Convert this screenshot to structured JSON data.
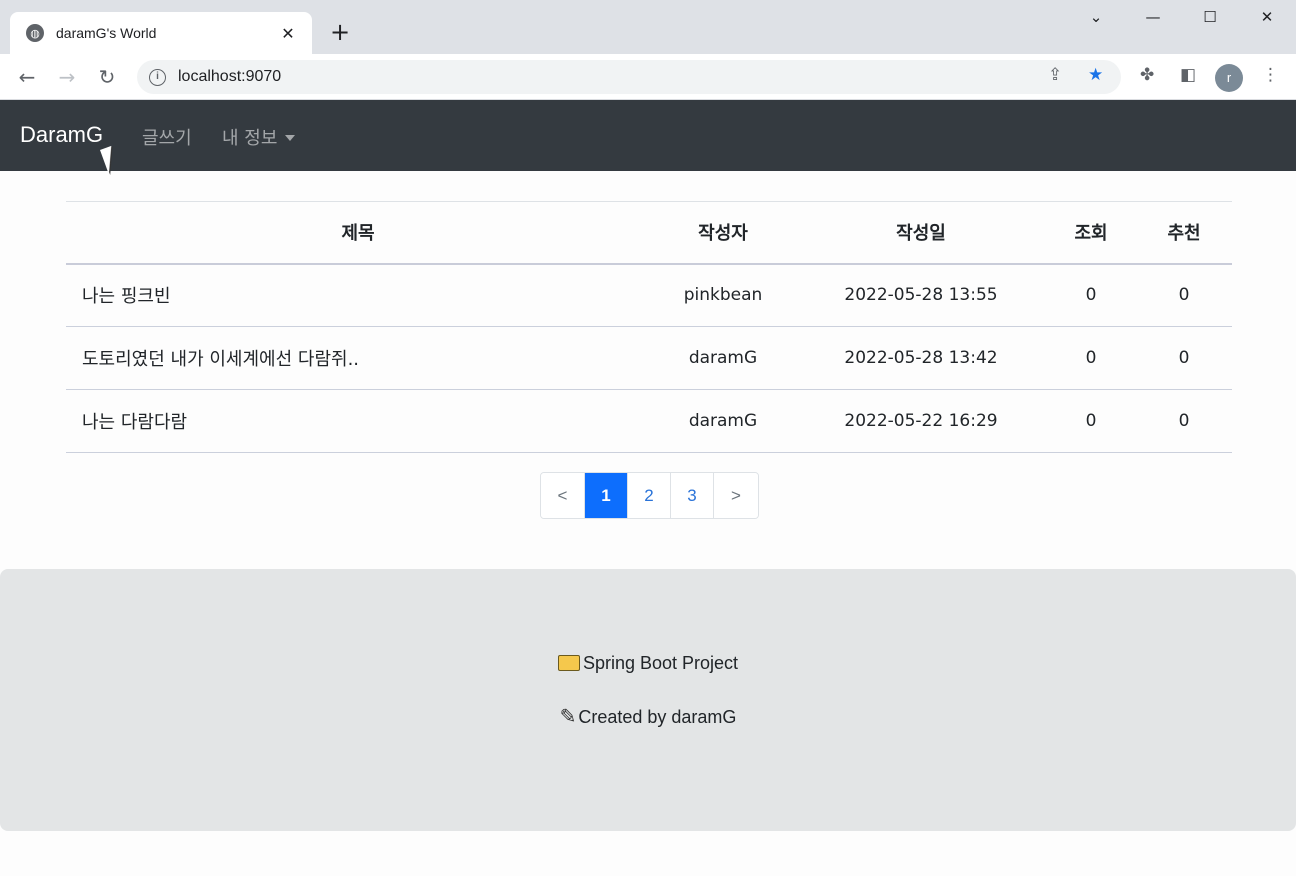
{
  "browser": {
    "tab_title": "daramG's World",
    "tab_close": "✕",
    "new_tab": "+",
    "url": "localhost:9070",
    "profile_initial": "r"
  },
  "navbar": {
    "brand": "DaramG",
    "write_link": "글쓰기",
    "my_info_link": "내 정보"
  },
  "table": {
    "headers": [
      "제목",
      "작성자",
      "작성일",
      "조회",
      "추천"
    ],
    "rows": [
      {
        "title": "나는 핑크빈",
        "author": "pinkbean",
        "date": "2022-05-28 13:55",
        "views": "0",
        "likes": "0"
      },
      {
        "title": "도토리였던 내가 이세계에선 다람쥐..",
        "author": "daramG",
        "date": "2022-05-28 13:42",
        "views": "0",
        "likes": "0"
      },
      {
        "title": "나는 다람다람",
        "author": "daramG",
        "date": "2022-05-22 16:29",
        "views": "0",
        "likes": "0"
      }
    ]
  },
  "pagination": {
    "prev": "<",
    "pages": [
      "1",
      "2",
      "3"
    ],
    "current": "1",
    "next": ">"
  },
  "footer": {
    "project": "Spring Boot Project",
    "credit": "Created by daramG"
  }
}
